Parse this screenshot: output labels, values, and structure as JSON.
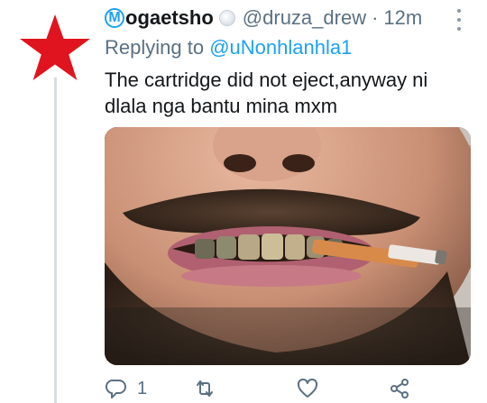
{
  "tweet": {
    "author": {
      "badge_letter": "M",
      "display_name": "ogaetsho",
      "handle": "@druza_drew",
      "separator": "·",
      "time": "12m",
      "avatar_icon": "red-star-icon",
      "avatar_color": "#e0141e"
    },
    "reply_context": {
      "prefix": "Replying to",
      "mention": "@uNonhlanhla1"
    },
    "text": "The cartridge did not eject,anyway ni dlala nga bantu mina mxm",
    "media": {
      "icon": "photo-icon"
    },
    "actions": {
      "reply_count": "1",
      "reply_icon": "reply-icon",
      "retweet_icon": "retweet-icon",
      "like_icon": "heart-icon",
      "share_icon": "share-icon"
    },
    "menu_icon": "more-icon",
    "accent_color": "#1da1f2",
    "muted_color": "#5b7083"
  }
}
